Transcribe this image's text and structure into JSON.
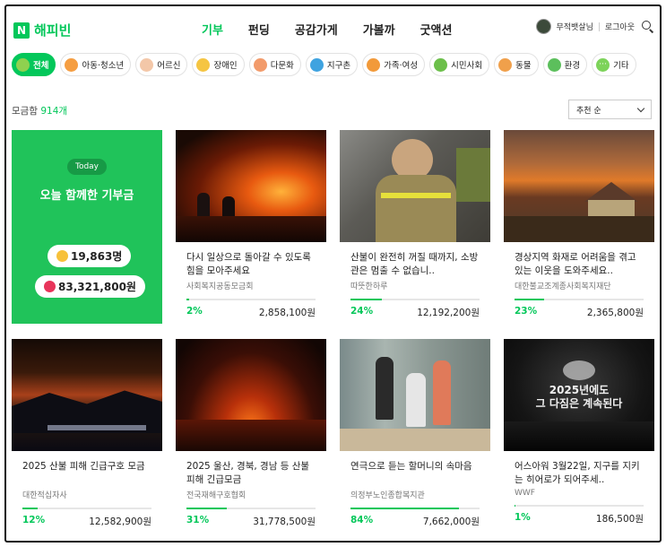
{
  "header": {
    "logo_mark": "N",
    "logo_text": "해피빈",
    "nav": [
      "기부",
      "펀딩",
      "공감가게",
      "가볼까",
      "굿액션"
    ],
    "user_name": "무적뱃살님",
    "logout": "로그아웃"
  },
  "categories": [
    {
      "label": "전체",
      "color": "#8fd14f"
    },
    {
      "label": "아동·청소년",
      "color": "#f59e42"
    },
    {
      "label": "어르신",
      "color": "#f3c7a8"
    },
    {
      "label": "장애인",
      "color": "#f5c542"
    },
    {
      "label": "다문화",
      "color": "#f29b6b"
    },
    {
      "label": "지구촌",
      "color": "#3fa3e0"
    },
    {
      "label": "가족·여성",
      "color": "#f29a3a"
    },
    {
      "label": "시민사회",
      "color": "#6cbf4a"
    },
    {
      "label": "동물",
      "color": "#f0a04b"
    },
    {
      "label": "환경",
      "color": "#5cbf5c"
    },
    {
      "label": "기타",
      "color": "#7dd35a"
    }
  ],
  "count": {
    "label": "모금함",
    "value": "914개"
  },
  "sort": {
    "label": "추천 순"
  },
  "today": {
    "badge": "Today",
    "title": "오늘 함께한 기부금",
    "people": "19,863명",
    "amount": "83,321,800원"
  },
  "cards": [
    {
      "title": "다시 일상으로 돌아갈 수 있도록 힘을 모아주세요",
      "org": "사회복지공동모금회",
      "percent": "2%",
      "progress": 0.02,
      "amount": "2,858,100원"
    },
    {
      "title": "산불이 완전히 꺼질 때까지, 소방관은 멈출 수 없습니..",
      "org": "따뜻한하루",
      "percent": "24%",
      "progress": 0.24,
      "amount": "12,192,200원"
    },
    {
      "title": "경상지역 화재로 어려움을 겪고 있는 이웃을 도와주세요..",
      "org": "대한불교조계종사회복지재단",
      "percent": "23%",
      "progress": 0.23,
      "amount": "2,365,800원"
    },
    {
      "title": "2025 산불 피해 긴급구호 모금",
      "org": "대한적십자사",
      "percent": "12%",
      "progress": 0.12,
      "amount": "12,582,900원"
    },
    {
      "title": "2025 울산, 경북, 경남 등 산불피해 긴급모금",
      "org": "전국재해구호협회",
      "percent": "31%",
      "progress": 0.31,
      "amount": "31,778,500원"
    },
    {
      "title": "연극으로 듣는 할머니의 속마음",
      "org": "의정부노인종합복지관",
      "percent": "84%",
      "progress": 0.84,
      "amount": "7,662,000원"
    },
    {
      "title": "어스아워 3월22일, 지구를 지키는 히어로가 되어주세..",
      "org": "WWF",
      "percent": "1%",
      "progress": 0.01,
      "amount": "186,500원"
    }
  ],
  "thumb_text": {
    "line1": "2025년에도",
    "line2": "그 다짐은 계속된다"
  }
}
